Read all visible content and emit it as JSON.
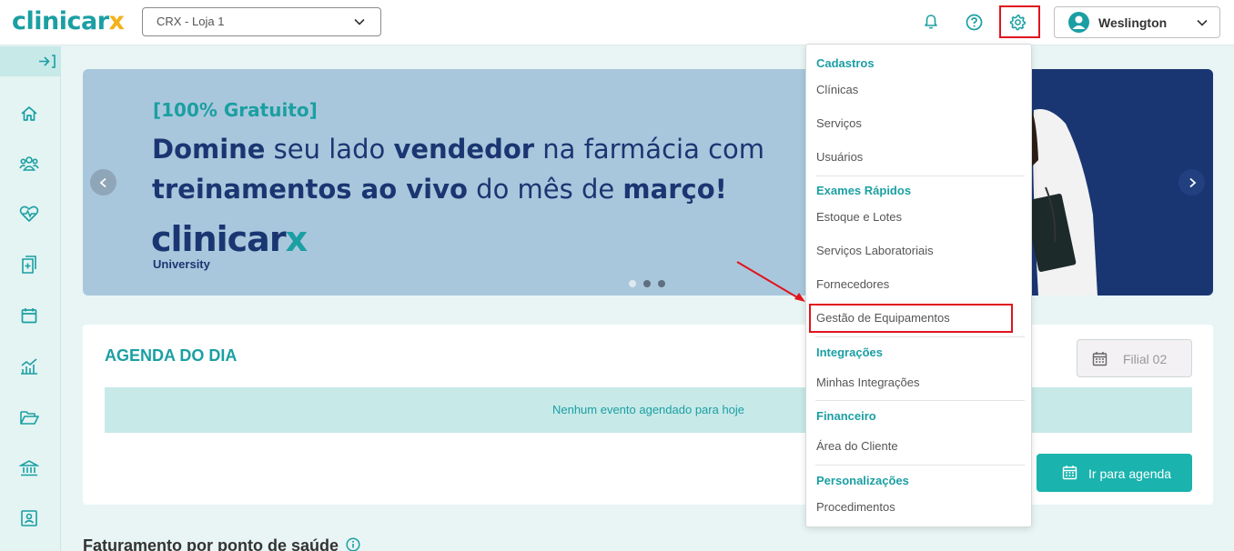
{
  "header": {
    "logo_main": "clinicar",
    "logo_accent": "x",
    "store_select_value": "CRX - Loja 1",
    "user_name": "Weslington"
  },
  "banner": {
    "tag": "[100% Gratuito]",
    "line1_bold1": "Domine",
    "line1_reg1": " seu lado ",
    "line1_bold2": "vendedor",
    "line1_reg2": " na farmácia com",
    "line2_bold1": "treinamentos ao vivo",
    "line2_reg1": " do mês de ",
    "line2_bold2": "março!",
    "logo_main": "clinicar",
    "logo_accent": "x",
    "logo_sub": "University",
    "slide_count": 3,
    "active_slide": 1
  },
  "agenda": {
    "title": "AGENDA DO DIA",
    "empty_message": "Nenhum evento agendado para hoje",
    "branch_placeholder": "Filial 02",
    "go_button": "Ir para agenda"
  },
  "bottom": {
    "title": "Faturamento por ponto de saúde"
  },
  "menu": {
    "cadastros": "Cadastros",
    "clinicas": "Clínicas",
    "servicos": "Serviços",
    "usuarios": "Usuários",
    "exames": "Exames Rápidos",
    "estoque": "Estoque e Lotes",
    "servicos_lab": "Serviços Laboratoriais",
    "fornecedores": "Fornecedores",
    "gestao": "Gestão de Equipamentos",
    "integracoes": "Integrações",
    "minhas_integracoes": "Minhas Integrações",
    "financeiro": "Financeiro",
    "area_cliente": "Área do Cliente",
    "personalizacoes": "Personalizações",
    "procedimentos": "Procedimentos"
  },
  "colors": {
    "brand_teal": "#1b9fa3",
    "brand_navy": "#1a3672",
    "highlight_red": "#e0141d",
    "accent_yellow": "#f5b11a"
  }
}
